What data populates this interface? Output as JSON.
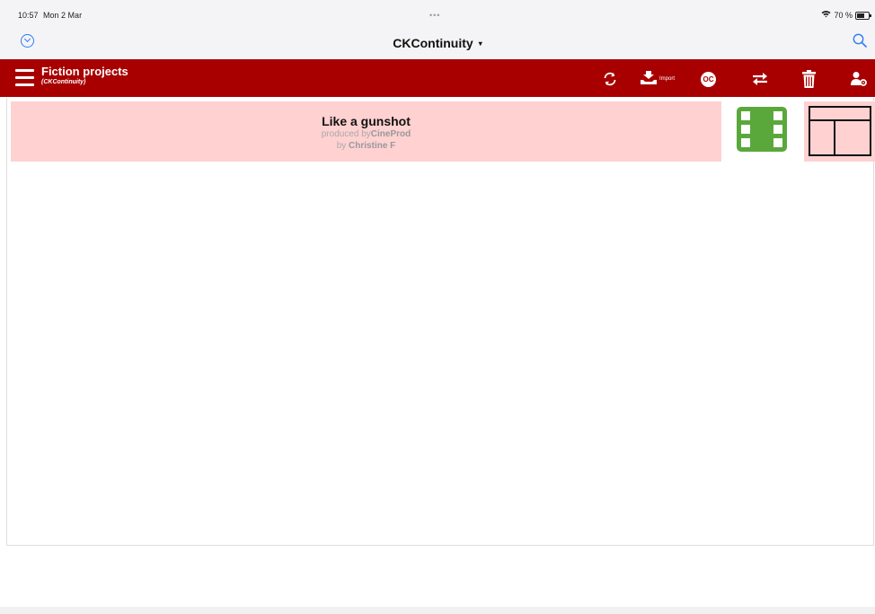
{
  "status_bar": {
    "time": "10:57",
    "date": "Mon 2 Mar",
    "dots": "•••",
    "battery": "70 %",
    "wifi_icon": "wifi-icon",
    "battery_icon": "battery-icon"
  },
  "nav": {
    "title": "CKContinuity",
    "caret": "▾",
    "left_icon": "chevron-circle-icon",
    "right_icon": "search-icon",
    "accent_color": "#2d7bf6"
  },
  "toolbar": {
    "title": "Fiction projects",
    "subtitle": "(CKContinuity)",
    "background_color": "#a80000",
    "import_label": "Import",
    "oc_label": "OC",
    "icons": [
      "menu-icon",
      "sync-icon",
      "import-icon",
      "oc-icon",
      "transfer-icon",
      "trash-icon",
      "user-settings-icon"
    ]
  },
  "projects": [
    {
      "title": "Like a gunshot",
      "produced_prefix": "produced by",
      "producer": "CineProd",
      "by_prefix": "by",
      "author": "Christine F",
      "row_color": "#ffd1d1",
      "film_icon": "film-icon",
      "film_color": "#5aa83c",
      "layout_icon": "layout-icon"
    }
  ]
}
